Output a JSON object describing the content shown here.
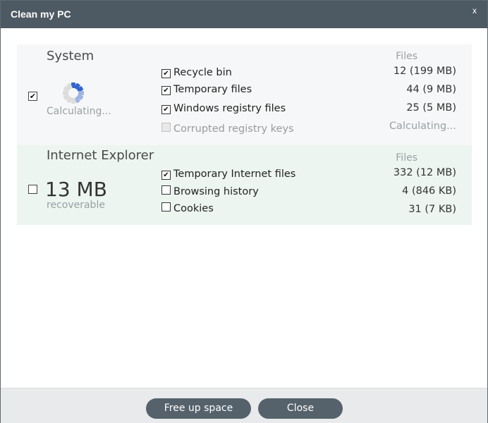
{
  "window": {
    "title": "Clean my PC",
    "close_label": "x"
  },
  "files_header": "Files",
  "system": {
    "title": "System",
    "checked": true,
    "status": "Calculating...",
    "items": [
      {
        "label": "Recycle bin",
        "checked": true,
        "disabled": false,
        "count": "12 (199 MB)"
      },
      {
        "label": "Temporary files",
        "checked": true,
        "disabled": false,
        "count": "44 (9 MB)"
      },
      {
        "label": "Windows registry files",
        "checked": true,
        "disabled": false,
        "count": "25 (5 MB)"
      },
      {
        "label": "Corrupted registry keys",
        "checked": false,
        "disabled": true,
        "count": "Calculating..."
      }
    ]
  },
  "ie": {
    "title": "Internet Explorer",
    "checked": false,
    "size": "13 MB",
    "size_caption": "recoverable",
    "items": [
      {
        "label": "Temporary Internet files",
        "checked": true,
        "disabled": false,
        "count": "332 (12 MB)"
      },
      {
        "label": "Browsing history",
        "checked": false,
        "disabled": false,
        "count": "4 (846 KB)"
      },
      {
        "label": "Cookies",
        "checked": false,
        "disabled": false,
        "count": "31 (7 KB)"
      }
    ]
  },
  "footer": {
    "free_label": "Free up space",
    "close_label": "Close"
  },
  "colors": {
    "titlebar": "#4d5963",
    "button": "#55626c",
    "system_bg": "#f6f7f8",
    "ie_bg": "#ecf5ef"
  }
}
